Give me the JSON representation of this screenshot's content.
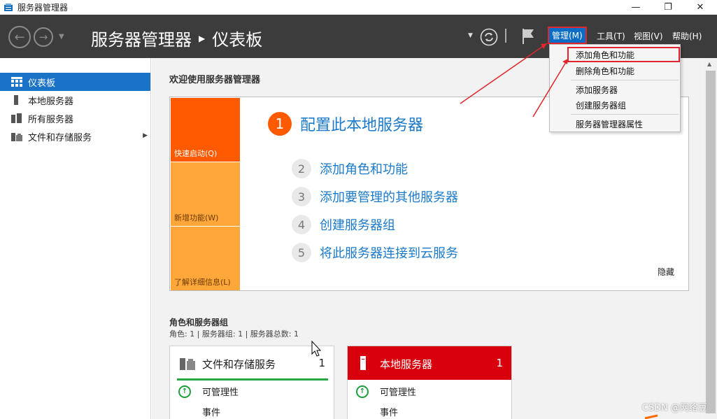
{
  "window": {
    "title": "服务器管理器",
    "minimize_icon": "minimize-icon",
    "restore_icon": "restore-icon",
    "close_icon": "close-icon"
  },
  "header": {
    "breadcrumb_app": "服务器管理器",
    "breadcrumb_page": "仪表板",
    "menus": {
      "manage": "管理(M)",
      "tools": "工具(T)",
      "view": "视图(V)",
      "help": "帮助(H)"
    }
  },
  "sidebar": {
    "items": [
      {
        "label": "仪表板",
        "icon": "dashboard-icon",
        "selected": true
      },
      {
        "label": "本地服务器",
        "icon": "server-icon"
      },
      {
        "label": "所有服务器",
        "icon": "servers-icon"
      },
      {
        "label": "文件和存储服务",
        "icon": "file-storage-icon",
        "has_arrow": true
      }
    ]
  },
  "main": {
    "welcome_title": "欢迎使用服务器管理器",
    "tiles": [
      "快速启动(Q)",
      "新增功能(W)",
      "了解详细信息(L)"
    ],
    "steps": [
      {
        "num": "1",
        "label": "配置此本地服务器"
      },
      {
        "num": "2",
        "label": "添加角色和功能"
      },
      {
        "num": "3",
        "label": "添加要管理的其他服务器"
      },
      {
        "num": "4",
        "label": "创建服务器组"
      },
      {
        "num": "5",
        "label": "将此服务器连接到云服务"
      }
    ],
    "hide_label": "隐藏",
    "roles_title": "角色和服务器组",
    "roles_summary": "角色: 1 | 服务器组: 1 | 服务器总数: 1",
    "cards": [
      {
        "title": "文件和存储服务",
        "count": "1",
        "rows": [
          "可管理性",
          "事件"
        ],
        "accent": "#27a745"
      },
      {
        "title": "本地服务器",
        "count": "1",
        "rows": [
          "可管理性",
          "事件"
        ],
        "accent": "#d8000c"
      }
    ]
  },
  "manage_menu": {
    "items": [
      "添加角色和功能",
      "删除角色和功能",
      "添加服务器",
      "创建服务器组",
      "服务器管理器属性"
    ]
  },
  "watermark": "CSDN @网络豆",
  "colors": {
    "header_bg": "#3c3c3c",
    "selection_blue": "#1a73c6",
    "quickstart_orange": "#ff5a00",
    "tile_light_orange": "#ffa73a",
    "link_blue": "#1b7ac9",
    "highlight_red": "#e0262b",
    "card_red": "#d8000c",
    "status_green": "#27a745"
  }
}
